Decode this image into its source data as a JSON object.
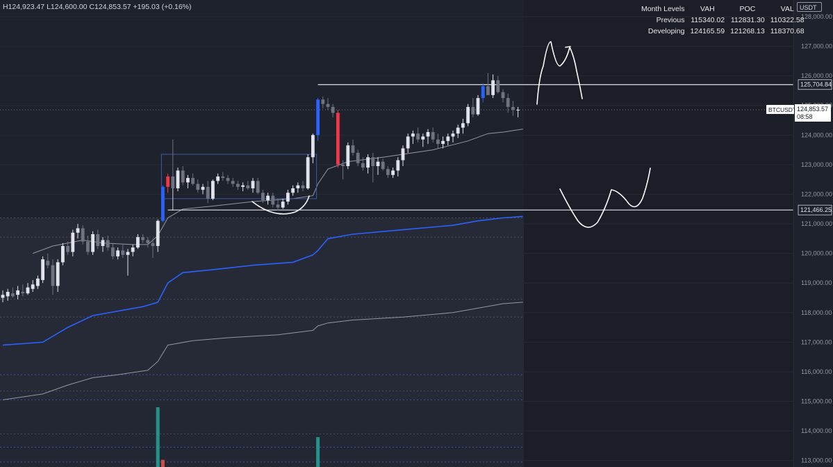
{
  "ohlc_header": {
    "high": "H124,923.47",
    "low": "L124,600.00",
    "close": "C124,853.57",
    "change": "+195.03 (+0.16%)"
  },
  "levels_table": {
    "columns": [
      "Month Levels",
      "VAH",
      "POC",
      "VAL"
    ],
    "rows": [
      {
        "label": "Previous",
        "vah": "115340.02",
        "poc": "112831.30",
        "val": "110322.58"
      },
      {
        "label": "Developing",
        "vah": "124165.59",
        "poc": "121268.13",
        "val": "118370.68"
      }
    ]
  },
  "axis_currency": "USDT",
  "price_labels": {
    "symbol": "BTCUSDT",
    "last_price": "124,853.57",
    "countdown": "08:58",
    "resistance": "125,704.84",
    "support": "121,466.25"
  },
  "colors": {
    "background": "#1e222d",
    "grid": "#2a2e39",
    "candle_up": "#d1d4dc",
    "candle_down": "#787b86",
    "candle_up_highlight": "#2962ff",
    "candle_down_highlight": "#f23645",
    "vwap_blue": "#2962ff",
    "vwap_gray": "#9598a1",
    "volume_up": "#26a69a",
    "volume_down": "#ef5350",
    "drawing": "#ffffff"
  },
  "chart_data": {
    "type": "candlestick",
    "symbol": "BTCUSDT",
    "quote": "USDT",
    "ylim": [
      112500,
      128000
    ],
    "y_ticks": [
      "113,000.00",
      "114,000.00",
      "115,000.00",
      "116,000.00",
      "117,000.00",
      "118,000.00",
      "119,000.00",
      "120,000.00",
      "121,000.00",
      "122,000.00",
      "123,000.00",
      "124,000.00",
      "125,000.00",
      "126,000.00",
      "127,000.00",
      "128,000.00"
    ],
    "horizontal_lines": [
      {
        "price": 125704.84,
        "label": "125,704.84",
        "style": "solid"
      },
      {
        "price": 121466.25,
        "label": "121,466.25",
        "style": "solid"
      },
      {
        "price": 124853.57,
        "label": "124,853.57",
        "style": "dotted"
      }
    ],
    "candles": [
      {
        "o": 118500,
        "h": 118750,
        "l": 118350,
        "c": 118600
      },
      {
        "o": 118550,
        "h": 118800,
        "l": 118400,
        "c": 118700
      },
      {
        "o": 118650,
        "h": 118850,
        "l": 118500,
        "c": 118550
      },
      {
        "o": 118600,
        "h": 118900,
        "l": 118450,
        "c": 118750
      },
      {
        "o": 118700,
        "h": 118950,
        "l": 118550,
        "c": 118650
      },
      {
        "o": 118650,
        "h": 119000,
        "l": 118600,
        "c": 118850
      },
      {
        "o": 118800,
        "h": 119100,
        "l": 118700,
        "c": 118950
      },
      {
        "o": 118900,
        "h": 119250,
        "l": 118800,
        "c": 119150
      },
      {
        "o": 119100,
        "h": 119900,
        "l": 119000,
        "c": 119800
      },
      {
        "o": 119750,
        "h": 120000,
        "l": 119500,
        "c": 119600
      },
      {
        "o": 119600,
        "h": 119800,
        "l": 118600,
        "c": 118900
      },
      {
        "o": 118900,
        "h": 119800,
        "l": 118700,
        "c": 119700
      },
      {
        "o": 119700,
        "h": 120350,
        "l": 119600,
        "c": 120250
      },
      {
        "o": 120250,
        "h": 120400,
        "l": 119950,
        "c": 120050
      },
      {
        "o": 120050,
        "h": 120800,
        "l": 119900,
        "c": 120700
      },
      {
        "o": 120700,
        "h": 121000,
        "l": 120500,
        "c": 120850
      },
      {
        "o": 120850,
        "h": 120950,
        "l": 120300,
        "c": 120400
      },
      {
        "o": 120400,
        "h": 120600,
        "l": 119950,
        "c": 120050
      },
      {
        "o": 120050,
        "h": 120750,
        "l": 119950,
        "c": 120650
      },
      {
        "o": 120650,
        "h": 120800,
        "l": 120150,
        "c": 120250
      },
      {
        "o": 120250,
        "h": 120550,
        "l": 120050,
        "c": 120450
      },
      {
        "o": 120450,
        "h": 120600,
        "l": 120100,
        "c": 120200
      },
      {
        "o": 120200,
        "h": 120350,
        "l": 119800,
        "c": 119900
      },
      {
        "o": 119900,
        "h": 120200,
        "l": 119800,
        "c": 120100
      },
      {
        "o": 120100,
        "h": 120300,
        "l": 119850,
        "c": 119950
      },
      {
        "o": 119950,
        "h": 120150,
        "l": 119250,
        "c": 120050
      },
      {
        "o": 120050,
        "h": 120300,
        "l": 119900,
        "c": 120200
      },
      {
        "o": 120200,
        "h": 120650,
        "l": 120150,
        "c": 120550
      },
      {
        "o": 120550,
        "h": 120650,
        "l": 120350,
        "c": 120450
      },
      {
        "o": 120450,
        "h": 120550,
        "l": 120200,
        "c": 120350
      },
      {
        "o": 120350,
        "h": 120500,
        "l": 119850,
        "c": 120250
      },
      {
        "o": 120250,
        "h": 121150,
        "l": 120050,
        "c": 121100
      },
      {
        "o": 121100,
        "h": 122300,
        "l": 121050,
        "c": 122250
      },
      {
        "o": 122250,
        "h": 122700,
        "l": 122050,
        "c": 122600
      },
      {
        "o": 122600,
        "h": 123850,
        "l": 122200,
        "c": 122200
      },
      {
        "o": 122200,
        "h": 122900,
        "l": 122100,
        "c": 122800
      },
      {
        "o": 122800,
        "h": 122950,
        "l": 122300,
        "c": 122400
      },
      {
        "o": 122400,
        "h": 122650,
        "l": 122200,
        "c": 122550
      },
      {
        "o": 122550,
        "h": 122700,
        "l": 122300,
        "c": 122350
      },
      {
        "o": 122350,
        "h": 122500,
        "l": 122050,
        "c": 122150
      },
      {
        "o": 122150,
        "h": 122350,
        "l": 122000,
        "c": 122250
      },
      {
        "o": 122250,
        "h": 122450,
        "l": 121700,
        "c": 121850
      },
      {
        "o": 121850,
        "h": 122500,
        "l": 121800,
        "c": 122450
      },
      {
        "o": 122450,
        "h": 122700,
        "l": 122350,
        "c": 122600
      },
      {
        "o": 122600,
        "h": 122750,
        "l": 122450,
        "c": 122550
      },
      {
        "o": 122550,
        "h": 122650,
        "l": 122350,
        "c": 122450
      },
      {
        "o": 122450,
        "h": 122550,
        "l": 122250,
        "c": 122350
      },
      {
        "o": 122350,
        "h": 122450,
        "l": 122150,
        "c": 122250
      },
      {
        "o": 122250,
        "h": 122400,
        "l": 122100,
        "c": 122300
      },
      {
        "o": 122300,
        "h": 122450,
        "l": 122150,
        "c": 122200
      },
      {
        "o": 122200,
        "h": 122550,
        "l": 122050,
        "c": 122450
      },
      {
        "o": 122450,
        "h": 122550,
        "l": 122000,
        "c": 122050
      },
      {
        "o": 122050,
        "h": 122150,
        "l": 121700,
        "c": 121800
      },
      {
        "o": 121800,
        "h": 122050,
        "l": 121650,
        "c": 121950
      },
      {
        "o": 121950,
        "h": 122050,
        "l": 121550,
        "c": 121650
      },
      {
        "o": 121650,
        "h": 121850,
        "l": 121450,
        "c": 121550
      },
      {
        "o": 121550,
        "h": 121850,
        "l": 121500,
        "c": 121750
      },
      {
        "o": 121750,
        "h": 122150,
        "l": 121650,
        "c": 122050
      },
      {
        "o": 122050,
        "h": 122300,
        "l": 121950,
        "c": 122200
      },
      {
        "o": 122200,
        "h": 122400,
        "l": 122050,
        "c": 122300
      },
      {
        "o": 122300,
        "h": 122450,
        "l": 122100,
        "c": 122200
      },
      {
        "o": 122200,
        "h": 123350,
        "l": 122150,
        "c": 123250
      },
      {
        "o": 123250,
        "h": 124050,
        "l": 123050,
        "c": 124000
      },
      {
        "o": 124000,
        "h": 125250,
        "l": 123800,
        "c": 125200
      },
      {
        "o": 125200,
        "h": 125300,
        "l": 124900,
        "c": 125050
      },
      {
        "o": 125050,
        "h": 125250,
        "l": 124850,
        "c": 124950
      },
      {
        "o": 124950,
        "h": 125050,
        "l": 124600,
        "c": 124750
      },
      {
        "o": 124750,
        "h": 124850,
        "l": 122900,
        "c": 123000
      },
      {
        "o": 123000,
        "h": 123150,
        "l": 122500,
        "c": 122950
      },
      {
        "o": 122950,
        "h": 123750,
        "l": 122850,
        "c": 123650
      },
      {
        "o": 123650,
        "h": 123850,
        "l": 123300,
        "c": 123400
      },
      {
        "o": 123400,
        "h": 123500,
        "l": 122950,
        "c": 123050
      },
      {
        "o": 123050,
        "h": 123250,
        "l": 122800,
        "c": 122900
      },
      {
        "o": 122900,
        "h": 123350,
        "l": 122700,
        "c": 123250
      },
      {
        "o": 123250,
        "h": 123400,
        "l": 122400,
        "c": 122950
      },
      {
        "o": 122950,
        "h": 123250,
        "l": 122650,
        "c": 123100
      },
      {
        "o": 123100,
        "h": 123200,
        "l": 122800,
        "c": 122850
      },
      {
        "o": 122850,
        "h": 122950,
        "l": 122550,
        "c": 122650
      },
      {
        "o": 122650,
        "h": 122900,
        "l": 122550,
        "c": 122800
      },
      {
        "o": 122800,
        "h": 123250,
        "l": 122600,
        "c": 123150
      },
      {
        "o": 123150,
        "h": 123650,
        "l": 122950,
        "c": 123550
      },
      {
        "o": 123550,
        "h": 124050,
        "l": 123400,
        "c": 123950
      },
      {
        "o": 123950,
        "h": 124150,
        "l": 123700,
        "c": 124050
      },
      {
        "o": 124050,
        "h": 124250,
        "l": 123750,
        "c": 123850
      },
      {
        "o": 123850,
        "h": 124050,
        "l": 123600,
        "c": 123950
      },
      {
        "o": 123950,
        "h": 124200,
        "l": 123700,
        "c": 124100
      },
      {
        "o": 124100,
        "h": 124250,
        "l": 123750,
        "c": 123850
      },
      {
        "o": 123850,
        "h": 124050,
        "l": 123550,
        "c": 123700
      },
      {
        "o": 123700,
        "h": 123950,
        "l": 123550,
        "c": 123800
      },
      {
        "o": 123800,
        "h": 124050,
        "l": 123650,
        "c": 123950
      },
      {
        "o": 123950,
        "h": 124150,
        "l": 123750,
        "c": 124050
      },
      {
        "o": 124050,
        "h": 124350,
        "l": 123900,
        "c": 124250
      },
      {
        "o": 124250,
        "h": 124550,
        "l": 124050,
        "c": 124400
      },
      {
        "o": 124400,
        "h": 125050,
        "l": 124300,
        "c": 124950
      },
      {
        "o": 124950,
        "h": 125250,
        "l": 124600,
        "c": 124700
      },
      {
        "o": 124700,
        "h": 125350,
        "l": 124650,
        "c": 125250
      },
      {
        "o": 125250,
        "h": 125750,
        "l": 125100,
        "c": 125650
      },
      {
        "o": 125650,
        "h": 126100,
        "l": 125450,
        "c": 125350
      },
      {
        "o": 125350,
        "h": 126050,
        "l": 125250,
        "c": 125850
      },
      {
        "o": 125850,
        "h": 126000,
        "l": 125400,
        "c": 125450
      },
      {
        "o": 125450,
        "h": 125550,
        "l": 125100,
        "c": 125250
      },
      {
        "o": 125250,
        "h": 125400,
        "l": 124750,
        "c": 124950
      },
      {
        "o": 124950,
        "h": 125150,
        "l": 124650,
        "c": 124850
      },
      {
        "o": 124850,
        "h": 124950,
        "l": 124600,
        "c": 124853.57
      }
    ],
    "highlight_up": [
      32,
      63,
      96
    ],
    "highlight_down": [
      33,
      67
    ],
    "vwap_blue": [
      [
        0,
        116900
      ],
      [
        8,
        117000
      ],
      [
        13,
        117500
      ],
      [
        18,
        117900
      ],
      [
        23,
        118050
      ],
      [
        28,
        118200
      ],
      [
        31,
        118350
      ],
      [
        33,
        119000
      ],
      [
        36,
        119350
      ],
      [
        42,
        119450
      ],
      [
        50,
        119600
      ],
      [
        58,
        119700
      ],
      [
        62,
        119950
      ],
      [
        63,
        120100
      ],
      [
        65,
        120500
      ],
      [
        70,
        120650
      ],
      [
        80,
        120800
      ],
      [
        90,
        120950
      ],
      [
        95,
        121100
      ],
      [
        100,
        121200
      ],
      [
        104,
        121250
      ]
    ],
    "vwap_gray_upper": [
      [
        6,
        120000
      ],
      [
        10,
        120250
      ],
      [
        16,
        120450
      ],
      [
        20,
        120350
      ],
      [
        26,
        120300
      ],
      [
        29,
        120300
      ],
      [
        31,
        120600
      ],
      [
        33,
        121200
      ],
      [
        36,
        121500
      ],
      [
        42,
        121600
      ],
      [
        50,
        121750
      ],
      [
        58,
        121850
      ],
      [
        62,
        121950
      ],
      [
        63,
        122350
      ],
      [
        65,
        122850
      ],
      [
        69,
        123100
      ],
      [
        76,
        123250
      ],
      [
        86,
        123500
      ],
      [
        93,
        123800
      ],
      [
        97,
        124050
      ],
      [
        100,
        124100
      ],
      [
        104,
        124200
      ]
    ],
    "vwap_gray_lower": [
      [
        0,
        115050
      ],
      [
        8,
        115250
      ],
      [
        13,
        115550
      ],
      [
        18,
        115800
      ],
      [
        23,
        115900
      ],
      [
        29,
        116050
      ],
      [
        31,
        116350
      ],
      [
        33,
        116900
      ],
      [
        38,
        117050
      ],
      [
        45,
        117150
      ],
      [
        55,
        117250
      ],
      [
        62,
        117400
      ],
      [
        63,
        117550
      ],
      [
        65,
        117650
      ],
      [
        70,
        117750
      ],
      [
        80,
        117850
      ],
      [
        90,
        118000
      ],
      [
        95,
        118150
      ],
      [
        100,
        118300
      ],
      [
        104,
        118350
      ]
    ],
    "value_areas": [
      {
        "top": 121200,
        "bottom": 115050
      }
    ],
    "dashed_lines": [
      121200,
      120550,
      118450,
      117850,
      115900,
      115350,
      115050,
      113900,
      113450,
      112950
    ],
    "volume_bars": [
      {
        "index": 31,
        "value": 1.0,
        "dir": "up"
      },
      {
        "index": 32,
        "value": 0.12,
        "dir": "down"
      },
      {
        "index": 63,
        "value": 0.5,
        "dir": "up"
      }
    ]
  }
}
